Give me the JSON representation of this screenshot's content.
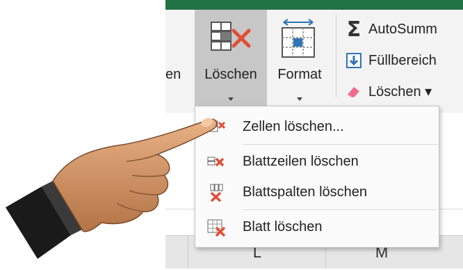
{
  "ribbon": {
    "cut_label": "en",
    "delete_button": "Löschen",
    "format_button": "Format",
    "autosum": "AutoSumm",
    "fill": "Füllbereich",
    "clear": "Löschen ▾"
  },
  "menu": {
    "items": [
      {
        "label": "Zellen löschen..."
      },
      {
        "label": "Blattzeilen löschen"
      },
      {
        "label": "Blattspalten löschen"
      },
      {
        "label": "Blatt löschen"
      }
    ]
  },
  "columns": [
    "L",
    "M"
  ],
  "colors": {
    "accent": "#217346",
    "delete_red": "#e04f36",
    "selected_button": "#c7c7c7",
    "ribbon_bg": "#f3f3f3"
  },
  "icons": [
    "delete-cells-icon",
    "format-icon",
    "sigma-icon",
    "fill-down-icon",
    "eraser-icon",
    "delete-rows-icon",
    "delete-columns-icon",
    "delete-sheet-icon",
    "pointing-hand-icon"
  ]
}
